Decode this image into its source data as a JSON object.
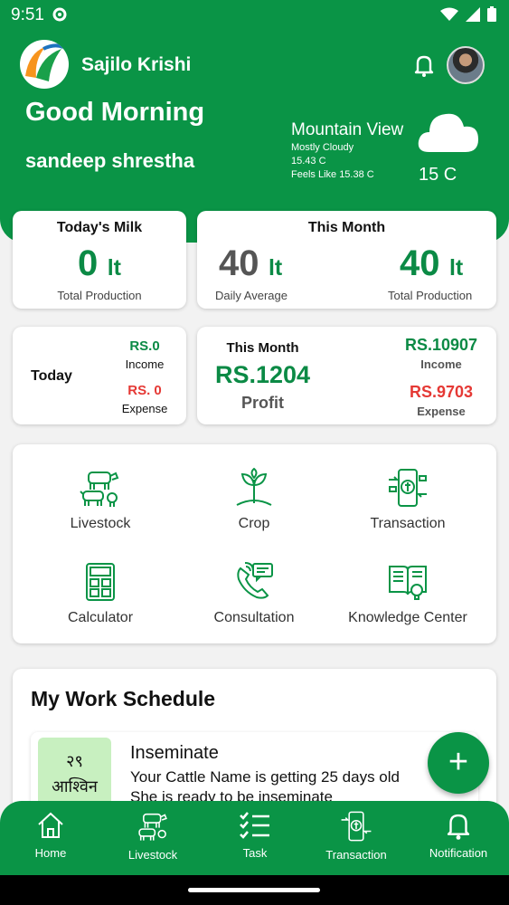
{
  "status": {
    "time": "9:51"
  },
  "app": {
    "name": "Sajilo Krishi"
  },
  "greeting": {
    "title": "Good Morning",
    "user": "sandeep shrestha"
  },
  "weather": {
    "location": "Mountain View",
    "condition": "Mostly Cloudy",
    "temp_detail": "15.43 C",
    "feels_like": "Feels Like 15.38 C",
    "temp": "15 C",
    "icon": "cloud-icon"
  },
  "milk": {
    "today_title": "Today's Milk",
    "today_value": "0",
    "unit": "lt",
    "today_caption": "Total Production",
    "month_title": "This Month",
    "daily_avg_value": "40",
    "daily_avg_caption": "Daily Average",
    "month_total_value": "40",
    "month_total_caption": "Total Production"
  },
  "finance": {
    "today_label": "Today",
    "today_income": "RS.0",
    "income_label": "Income",
    "today_expense": "RS. 0",
    "expense_label": "Expense",
    "month_title": "This Month",
    "month_profit": "RS.1204",
    "profit_label": "Profit",
    "month_income": "RS.10907",
    "month_expense": "RS.9703"
  },
  "menu": [
    {
      "label": "Livestock",
      "icon": "livestock-icon"
    },
    {
      "label": "Crop",
      "icon": "crop-icon"
    },
    {
      "label": "Transaction",
      "icon": "transaction-icon"
    },
    {
      "label": "Calculator",
      "icon": "calculator-icon"
    },
    {
      "label": "Consultation",
      "icon": "consultation-icon"
    },
    {
      "label": "Knowledge Center",
      "icon": "knowledge-center-icon"
    }
  ],
  "schedule": {
    "title": "My Work Schedule",
    "item": {
      "day": "२९",
      "month": "आश्विन",
      "title": "Inseminate",
      "line1": "Your Cattle Name is getting 25 days old",
      "line2": "She is ready to be inseminate"
    }
  },
  "fab": {
    "label": "+"
  },
  "nav": [
    {
      "label": "Home",
      "icon": "home-icon"
    },
    {
      "label": "Livestock",
      "icon": "livestock-icon"
    },
    {
      "label": "Task",
      "icon": "task-icon"
    },
    {
      "label": "Transaction",
      "icon": "transaction-icon"
    },
    {
      "label": "Notification",
      "icon": "bell-icon"
    }
  ],
  "colors": {
    "primary": "#0a9446",
    "income": "#0b8a45",
    "expense": "#e53935"
  }
}
